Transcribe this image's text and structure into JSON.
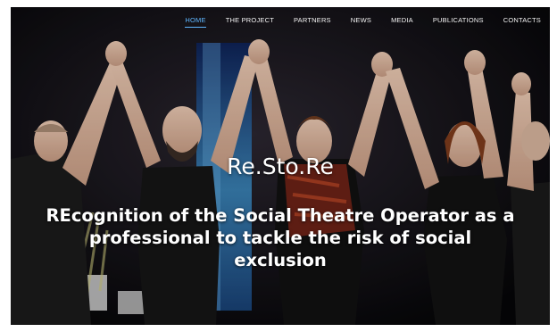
{
  "nav": {
    "items": [
      {
        "label": "HOME",
        "active": true
      },
      {
        "label": "THE PROJECT",
        "active": false
      },
      {
        "label": "PARTNERS",
        "active": false
      },
      {
        "label": "NEWS",
        "active": false
      },
      {
        "label": "MEDIA",
        "active": false
      },
      {
        "label": "PUBLICATIONS",
        "active": false
      },
      {
        "label": "CONTACTS",
        "active": false
      }
    ]
  },
  "hero": {
    "title": "Re.Sto.Re",
    "subtitle_line1": "REcognition of the Social Theatre Operator as a",
    "subtitle_line2": "professional to tackle the risk of social",
    "subtitle_line3": "exclusion"
  },
  "colors": {
    "active_nav": "#5fb6ff",
    "nav_text": "#f4f4f4",
    "background": "#000000"
  }
}
